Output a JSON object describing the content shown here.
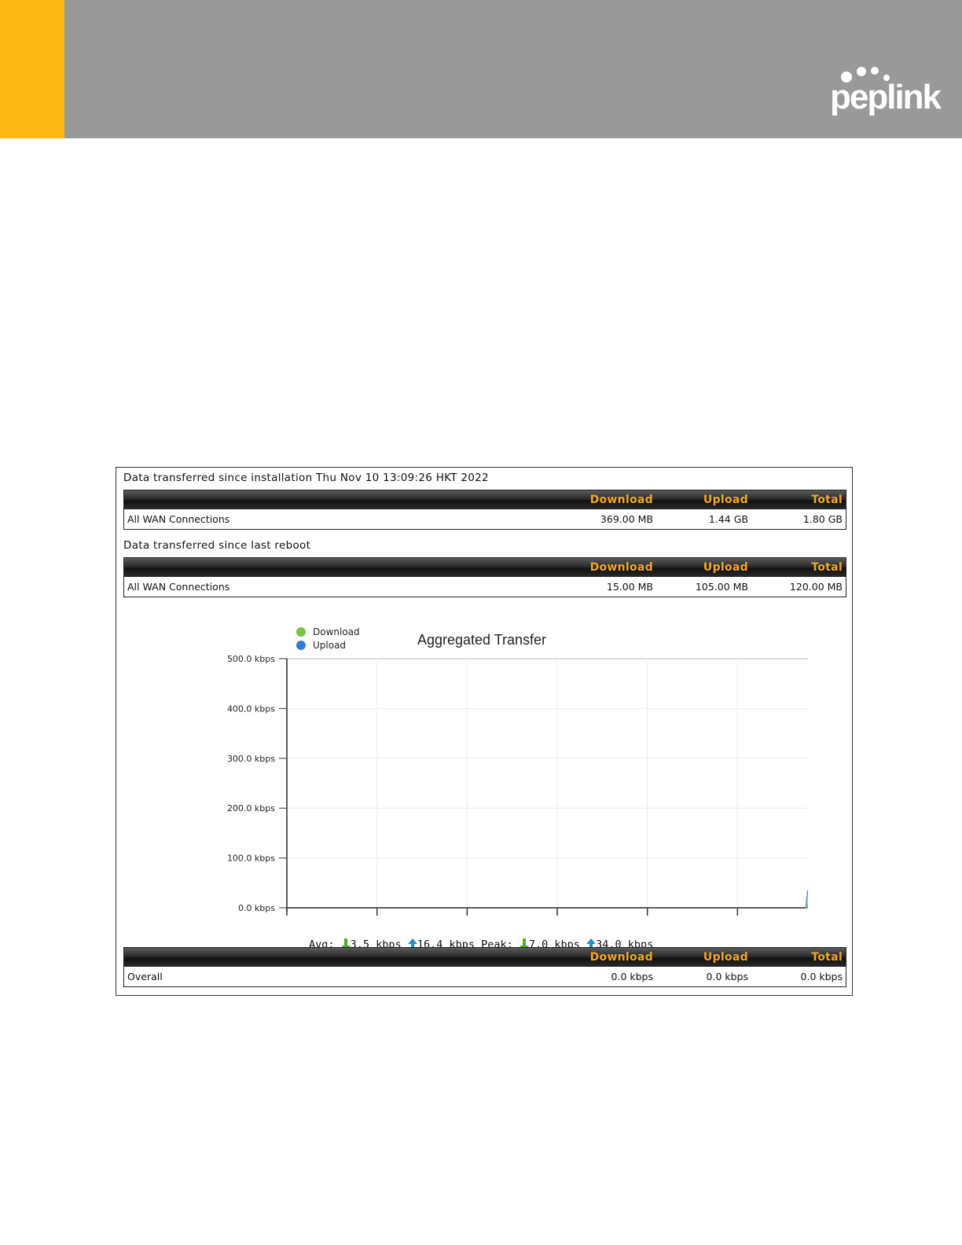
{
  "header": {
    "brand": "peplink",
    "colors": {
      "bar": "#999999",
      "accent": "#fdb913"
    }
  },
  "install_section": {
    "caption": "Data transferred since installation Thu Nov 10 13:09:26 HKT 2022",
    "columns": {
      "download": "Download",
      "upload": "Upload",
      "total": "Total"
    },
    "row": {
      "name": "All WAN Connections",
      "download": "369.00 MB",
      "upload": "1.44 GB",
      "total": "1.80 GB"
    }
  },
  "reboot_section": {
    "caption": "Data transferred since last reboot",
    "columns": {
      "download": "Download",
      "upload": "Upload",
      "total": "Total"
    },
    "row": {
      "name": "All WAN Connections",
      "download": "15.00 MB",
      "upload": "105.00 MB",
      "total": "120.00 MB"
    }
  },
  "chart_data": {
    "type": "area",
    "title": "Aggregated Transfer",
    "legend": [
      {
        "name": "Download",
        "color": "#7cc242"
      },
      {
        "name": "Upload",
        "color": "#2f7ed8"
      }
    ],
    "legend_position": "top-left",
    "y_ticks": [
      "0.0 kbps",
      "100.0 kbps",
      "200.0 kbps",
      "300.0 kbps",
      "400.0 kbps",
      "500.0 kbps"
    ],
    "ylim": [
      0,
      500
    ],
    "grid": true,
    "series": [
      {
        "name": "Upload",
        "values": [
          0,
          34,
          28,
          10,
          24,
          8,
          4,
          12,
          16,
          6,
          0
        ]
      },
      {
        "name": "Download",
        "values": [
          0,
          7,
          5,
          2,
          4,
          3,
          1,
          2,
          3,
          1,
          0
        ]
      }
    ]
  },
  "rate_summary": {
    "avg_label": "Avg:",
    "avg_download": "3.5 kbps",
    "avg_upload": "16.4 kbps",
    "peak_label": "Peak:",
    "peak_download": "7.0 kbps",
    "peak_upload": "34.0 kbps"
  },
  "overall_section": {
    "columns": {
      "download": "Download",
      "upload": "Upload",
      "total": "Total"
    },
    "row": {
      "name": "Overall",
      "download": "0.0 kbps",
      "upload": "0.0 kbps",
      "total": "0.0 kbps"
    }
  }
}
